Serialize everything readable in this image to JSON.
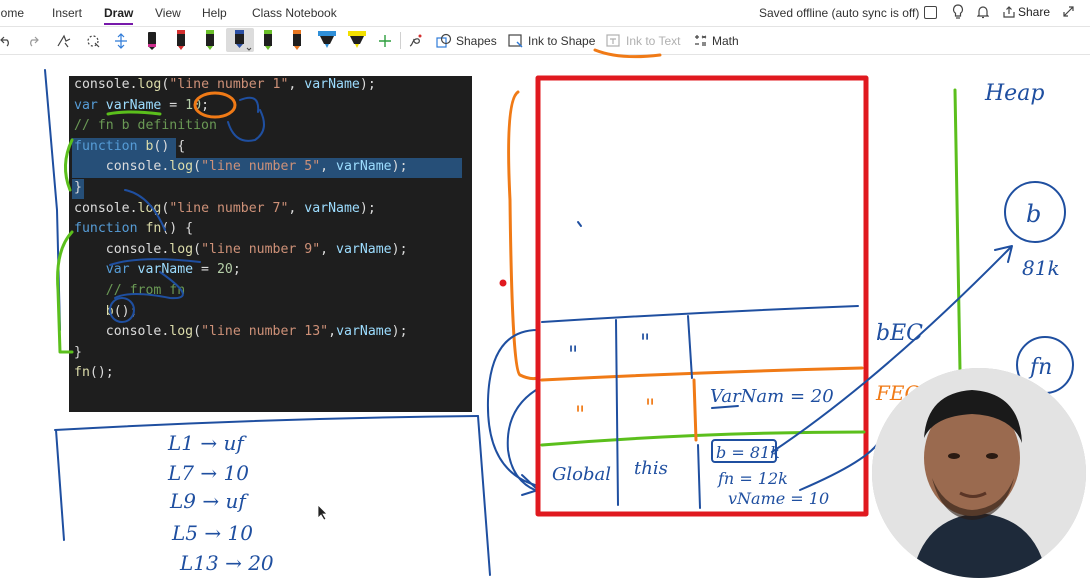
{
  "menubar": {
    "items": [
      {
        "label": "Home"
      },
      {
        "label": "Insert"
      },
      {
        "label": "Draw",
        "active": true
      },
      {
        "label": "View"
      },
      {
        "label": "Help"
      },
      {
        "label": "Class Notebook"
      }
    ],
    "status": "Saved offline (auto sync is off)",
    "share_label": "Share"
  },
  "toolbar": {
    "pens": [
      {
        "color": "#1f1f1f",
        "icon": "pen-icon"
      },
      {
        "color": "#d32f2f",
        "icon": "pen-icon"
      },
      {
        "color": "#6abf2a",
        "icon": "pen-icon"
      },
      {
        "color": "#2b4fa3",
        "icon": "pen-icon",
        "selected": true
      },
      {
        "color": "#6abf2a",
        "icon": "pen-icon"
      },
      {
        "color": "#e87722",
        "icon": "pen-icon"
      },
      {
        "color": "#2f8fd8",
        "icon": "highlighter-icon"
      },
      {
        "color": "#f2e000",
        "icon": "highlighter-icon"
      }
    ],
    "shapes_label": "Shapes",
    "ink_to_shape_label": "Ink to Shape",
    "ink_to_text_label": "Ink to Text",
    "math_label": "Math"
  },
  "code": {
    "lines": [
      {
        "tokens": [
          {
            "t": "console.",
            "c": ""
          },
          {
            "t": "log",
            "c": "fn"
          },
          {
            "t": "(",
            "c": ""
          },
          {
            "t": "\"line number 1\"",
            "c": "str"
          },
          {
            "t": ", ",
            "c": ""
          },
          {
            "t": "varName",
            "c": "var"
          },
          {
            "t": ");",
            "c": ""
          }
        ]
      },
      {
        "tokens": [
          {
            "t": "var ",
            "c": "kw"
          },
          {
            "t": "varName",
            "c": "var"
          },
          {
            "t": " = ",
            "c": ""
          },
          {
            "t": "10",
            "c": "num"
          },
          {
            "t": ";",
            "c": ""
          }
        ]
      },
      {
        "tokens": [
          {
            "t": "// fn b definition",
            "c": "cmt"
          }
        ]
      },
      {
        "tokens": [
          {
            "t": "function ",
            "c": "kw"
          },
          {
            "t": "b",
            "c": "fn"
          },
          {
            "t": "() {",
            "c": ""
          }
        ]
      },
      {
        "tokens": [
          {
            "t": "    console.",
            "c": ""
          },
          {
            "t": "log",
            "c": "fn"
          },
          {
            "t": "(",
            "c": ""
          },
          {
            "t": "\"line number 5\"",
            "c": "str"
          },
          {
            "t": ", ",
            "c": ""
          },
          {
            "t": "varName",
            "c": "var"
          },
          {
            "t": ");",
            "c": ""
          }
        ]
      },
      {
        "tokens": [
          {
            "t": "}",
            "c": ""
          }
        ]
      },
      {
        "tokens": [
          {
            "t": "console.",
            "c": ""
          },
          {
            "t": "log",
            "c": "fn"
          },
          {
            "t": "(",
            "c": ""
          },
          {
            "t": "\"line number 7\"",
            "c": "str"
          },
          {
            "t": ", ",
            "c": ""
          },
          {
            "t": "varName",
            "c": "var"
          },
          {
            "t": ");",
            "c": ""
          }
        ]
      },
      {
        "tokens": [
          {
            "t": "function ",
            "c": "kw"
          },
          {
            "t": "fn",
            "c": "fn"
          },
          {
            "t": "() {",
            "c": ""
          }
        ]
      },
      {
        "tokens": [
          {
            "t": "    console.",
            "c": ""
          },
          {
            "t": "log",
            "c": "fn"
          },
          {
            "t": "(",
            "c": ""
          },
          {
            "t": "\"line number 9\"",
            "c": "str"
          },
          {
            "t": ", ",
            "c": ""
          },
          {
            "t": "varName",
            "c": "var"
          },
          {
            "t": ");",
            "c": ""
          }
        ]
      },
      {
        "tokens": [
          {
            "t": "    var ",
            "c": "kw"
          },
          {
            "t": "varName",
            "c": "var"
          },
          {
            "t": " = ",
            "c": ""
          },
          {
            "t": "20",
            "c": "num"
          },
          {
            "t": ";",
            "c": ""
          }
        ]
      },
      {
        "tokens": [
          {
            "t": "    // from fn",
            "c": "cmt"
          }
        ]
      },
      {
        "tokens": [
          {
            "t": "    ",
            "c": ""
          },
          {
            "t": "b",
            "c": "fn"
          },
          {
            "t": "();",
            "c": ""
          }
        ]
      },
      {
        "tokens": [
          {
            "t": "    console.",
            "c": ""
          },
          {
            "t": "log",
            "c": "fn"
          },
          {
            "t": "(",
            "c": ""
          },
          {
            "t": "\"line number 13\"",
            "c": "str"
          },
          {
            "t": ",",
            "c": ""
          },
          {
            "t": "varName",
            "c": "var"
          },
          {
            "t": ");",
            "c": ""
          }
        ]
      },
      {
        "tokens": [
          {
            "t": "}",
            "c": ""
          }
        ]
      },
      {
        "tokens": [
          {
            "t": "fn",
            "c": "fn"
          },
          {
            "t": "();",
            "c": ""
          }
        ]
      }
    ]
  },
  "handwriting": {
    "output_lines": [
      "L1 → uf",
      "L7 → 10",
      "L9 → uf",
      "L5 → 10",
      "L13 → 20"
    ],
    "heap_label": "Heap",
    "heap_b": "b",
    "heap_b_addr": "81k",
    "heap_fn": "fn",
    "bec_label": "bEC",
    "fec_label": "FEC",
    "stack_row1": [
      "\"",
      "\""
    ],
    "stack_row2": [
      "\"",
      "\""
    ],
    "varname_20": "VarNam = 20",
    "global_label": "Global",
    "this_label": "this",
    "b_ref": "b = 81k",
    "fn_ref": "fn = 12k",
    "vname_ref": "vName = 10"
  },
  "colors": {
    "accent": "#7719aa",
    "ink_blue": "#1f4fa0",
    "ink_green": "#5bbf1c",
    "ink_orange": "#f07a16",
    "ink_red": "#e0191f"
  }
}
